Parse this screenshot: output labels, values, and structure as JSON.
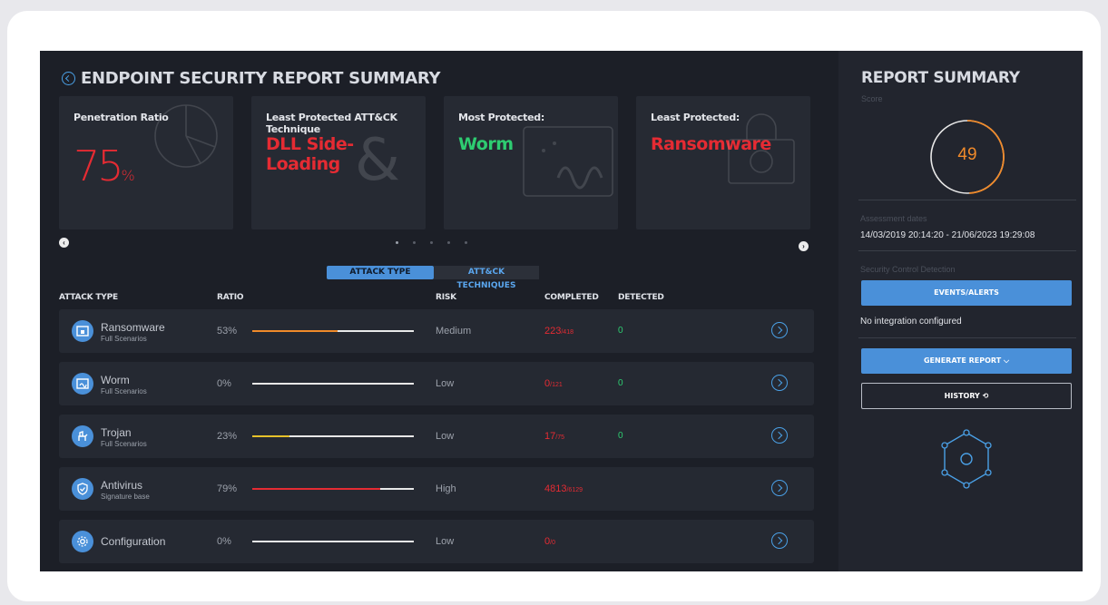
{
  "header": {
    "title": "ENDPOINT SECURITY REPORT SUMMARY"
  },
  "tiles": {
    "penetration": {
      "label": "Penetration Ratio",
      "value": "75",
      "unit": "%"
    },
    "least_technique": {
      "label": "Least Protected ATT&CK Technique",
      "value": "DLL Side-Loading"
    },
    "most_protected": {
      "label": "Most Protected:",
      "value": "Worm"
    },
    "least_protected": {
      "label": "Least Protected:",
      "value": "Ransomware"
    }
  },
  "tabs": [
    {
      "label": "ATTACK TYPE",
      "active": true
    },
    {
      "label": "ATT&CK TECHNIQUES",
      "active": false
    }
  ],
  "table": {
    "headers": [
      "ATTACK TYPE",
      "RATIO",
      "RISK",
      "COMPLETED",
      "DETECTED"
    ],
    "rows": [
      {
        "name": "Ransomware",
        "sub": "Full Scenarios",
        "ratio": "53%",
        "ratio_value": 0.53,
        "bar_color": "#f08a2a",
        "risk": "Medium",
        "completed": "223",
        "total": "/418",
        "detected": "0",
        "icon": "lock-screen-icon"
      },
      {
        "name": "Worm",
        "sub": "Full Scenarios",
        "ratio": "0%",
        "ratio_value": 0,
        "bar_color": "#e8e8e8",
        "risk": "Low",
        "completed": "0",
        "total": "/121",
        "detected": "0",
        "icon": "worm-icon"
      },
      {
        "name": "Trojan",
        "sub": "Full Scenarios",
        "ratio": "23%",
        "ratio_value": 0.23,
        "bar_color": "#e6c12a",
        "risk": "Low",
        "completed": "17",
        "total": "/75",
        "detected": "0",
        "icon": "trojan-horse-icon"
      },
      {
        "name": "Antivirus",
        "sub": "Signature base",
        "ratio": "79%",
        "ratio_value": 0.79,
        "bar_color": "#e52b33",
        "risk": "High",
        "completed": "4813",
        "total": "/6129",
        "detected": "",
        "icon": "shield-check-icon"
      },
      {
        "name": "Configuration",
        "sub": "",
        "ratio": "0%",
        "ratio_value": 0,
        "bar_color": "#e8e8e8",
        "risk": "Low",
        "completed": "0",
        "total": "/0",
        "detected": "",
        "icon": "gear-icon"
      }
    ]
  },
  "sidebar": {
    "title": "REPORT SUMMARY",
    "score_label": "Score",
    "score": "49",
    "score_value": 0.49,
    "assessment_label": "Assessment dates",
    "dates": "14/03/2019 20:14:20 - 21/06/2023 19:29:08",
    "detection_label": "Security Control Detection",
    "events_button": "EVENTS/ALERTS",
    "no_integration": "No integration configured",
    "generate_button": "GENERATE REPORT ⌵",
    "history_button": "HISTORY ⟲"
  },
  "colors": {
    "accent": "#4a90d9",
    "danger": "#e52b33",
    "success": "#2ecc71",
    "score": "#f08a2a"
  }
}
